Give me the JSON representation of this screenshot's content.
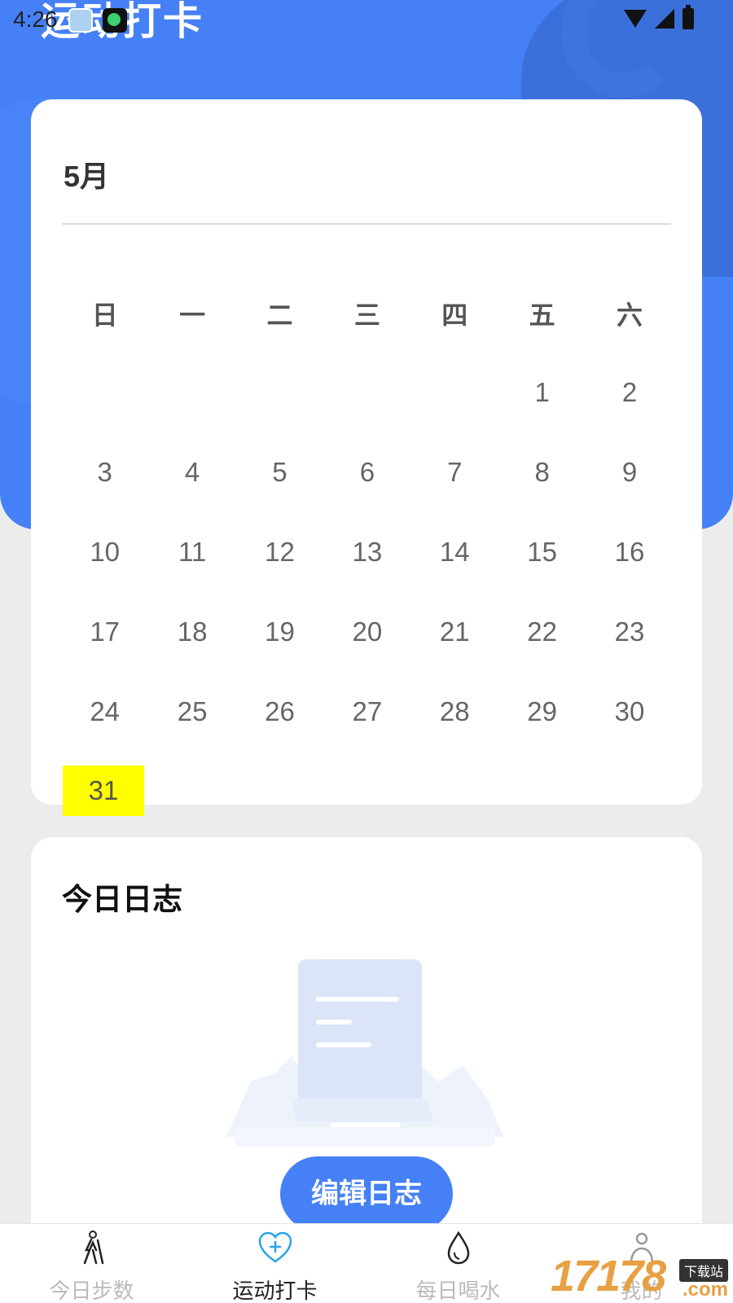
{
  "status_bar": {
    "time": "4:26"
  },
  "header": {
    "title": "运动打卡"
  },
  "calendar": {
    "month": "5月",
    "weekdays": [
      "日",
      "一",
      "二",
      "三",
      "四",
      "五",
      "六"
    ],
    "weeks": [
      [
        "",
        "",
        "",
        "",
        "",
        "1",
        "2"
      ],
      [
        "3",
        "4",
        "5",
        "6",
        "7",
        "8",
        "9"
      ],
      [
        "10",
        "11",
        "12",
        "13",
        "14",
        "15",
        "16"
      ],
      [
        "17",
        "18",
        "19",
        "20",
        "21",
        "22",
        "23"
      ],
      [
        "24",
        "25",
        "26",
        "27",
        "28",
        "29",
        "30"
      ],
      [
        "31"
      ]
    ],
    "today": "31",
    "today_highlight": "#ffff00"
  },
  "log": {
    "title": "今日日志",
    "edit_button": "编辑日志"
  },
  "nav": {
    "items": [
      {
        "label": "今日步数",
        "icon": "hiking-icon",
        "active": false
      },
      {
        "label": "运动打卡",
        "icon": "heart-plus-icon",
        "active": true
      },
      {
        "label": "每日喝水",
        "icon": "water-drop-icon",
        "active": false
      },
      {
        "label": "我的",
        "icon": "person-icon",
        "active": false
      }
    ]
  },
  "watermark": {
    "main": "17178",
    "badge": "下载站",
    "sub": ".com"
  },
  "colors": {
    "primary": "#4680f6",
    "background": "#ececec",
    "today": "#ffff00"
  }
}
